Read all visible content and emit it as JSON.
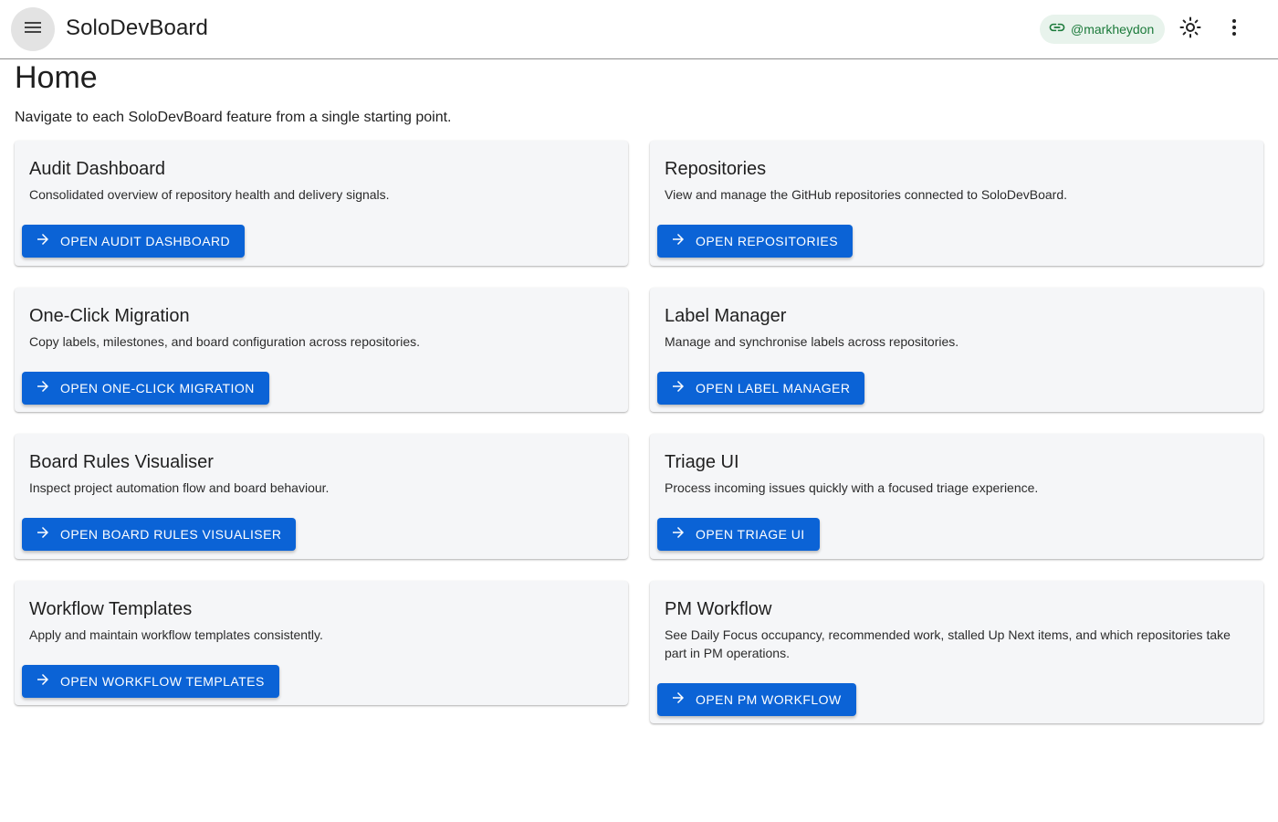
{
  "app": {
    "title": "SoloDevBoard",
    "menu_icon": "menu-icon",
    "user_chip": {
      "icon": "link-icon",
      "label": "@markheydon"
    },
    "theme_icon": "sun-icon",
    "more_icon": "more-vert-icon"
  },
  "page": {
    "title": "Home",
    "description": "Navigate to each SoloDevBoard feature from a single starting point."
  },
  "cards": [
    {
      "title": "Audit Dashboard",
      "description": "Consolidated overview of repository health and delivery signals.",
      "button_label": "OPEN AUDIT DASHBOARD",
      "button_icon": "arrow-forward-icon"
    },
    {
      "title": "Repositories",
      "description": "View and manage the GitHub repositories connected to SoloDevBoard.",
      "button_label": "OPEN REPOSITORIES",
      "button_icon": "arrow-forward-icon"
    },
    {
      "title": "One-Click Migration",
      "description": "Copy labels, milestones, and board configuration across repositories.",
      "button_label": "OPEN ONE-CLICK MIGRATION",
      "button_icon": "arrow-forward-icon"
    },
    {
      "title": "Label Manager",
      "description": "Manage and synchronise labels across repositories.",
      "button_label": "OPEN LABEL MANAGER",
      "button_icon": "arrow-forward-icon"
    },
    {
      "title": "Board Rules Visualiser",
      "description": "Inspect project automation flow and board behaviour.",
      "button_label": "OPEN BOARD RULES VISUALISER",
      "button_icon": "arrow-forward-icon"
    },
    {
      "title": "Triage UI",
      "description": "Process incoming issues quickly with a focused triage experience.",
      "button_label": "OPEN TRIAGE UI",
      "button_icon": "arrow-forward-icon"
    },
    {
      "title": "Workflow Templates",
      "description": "Apply and maintain workflow templates consistently.",
      "button_label": "OPEN WORKFLOW TEMPLATES",
      "button_icon": "arrow-forward-icon"
    },
    {
      "title": "PM Workflow",
      "description": "See Daily Focus occupancy, recommended work, stalled Up Next items, and which repositories take part in PM operations.",
      "button_label": "OPEN PM WORKFLOW",
      "button_icon": "arrow-forward-icon"
    }
  ],
  "colors": {
    "primary": "#0b63d6",
    "chip_bg": "#e8f3ec",
    "chip_text": "#1b7a3a",
    "card_bg": "#f5f6f8"
  }
}
